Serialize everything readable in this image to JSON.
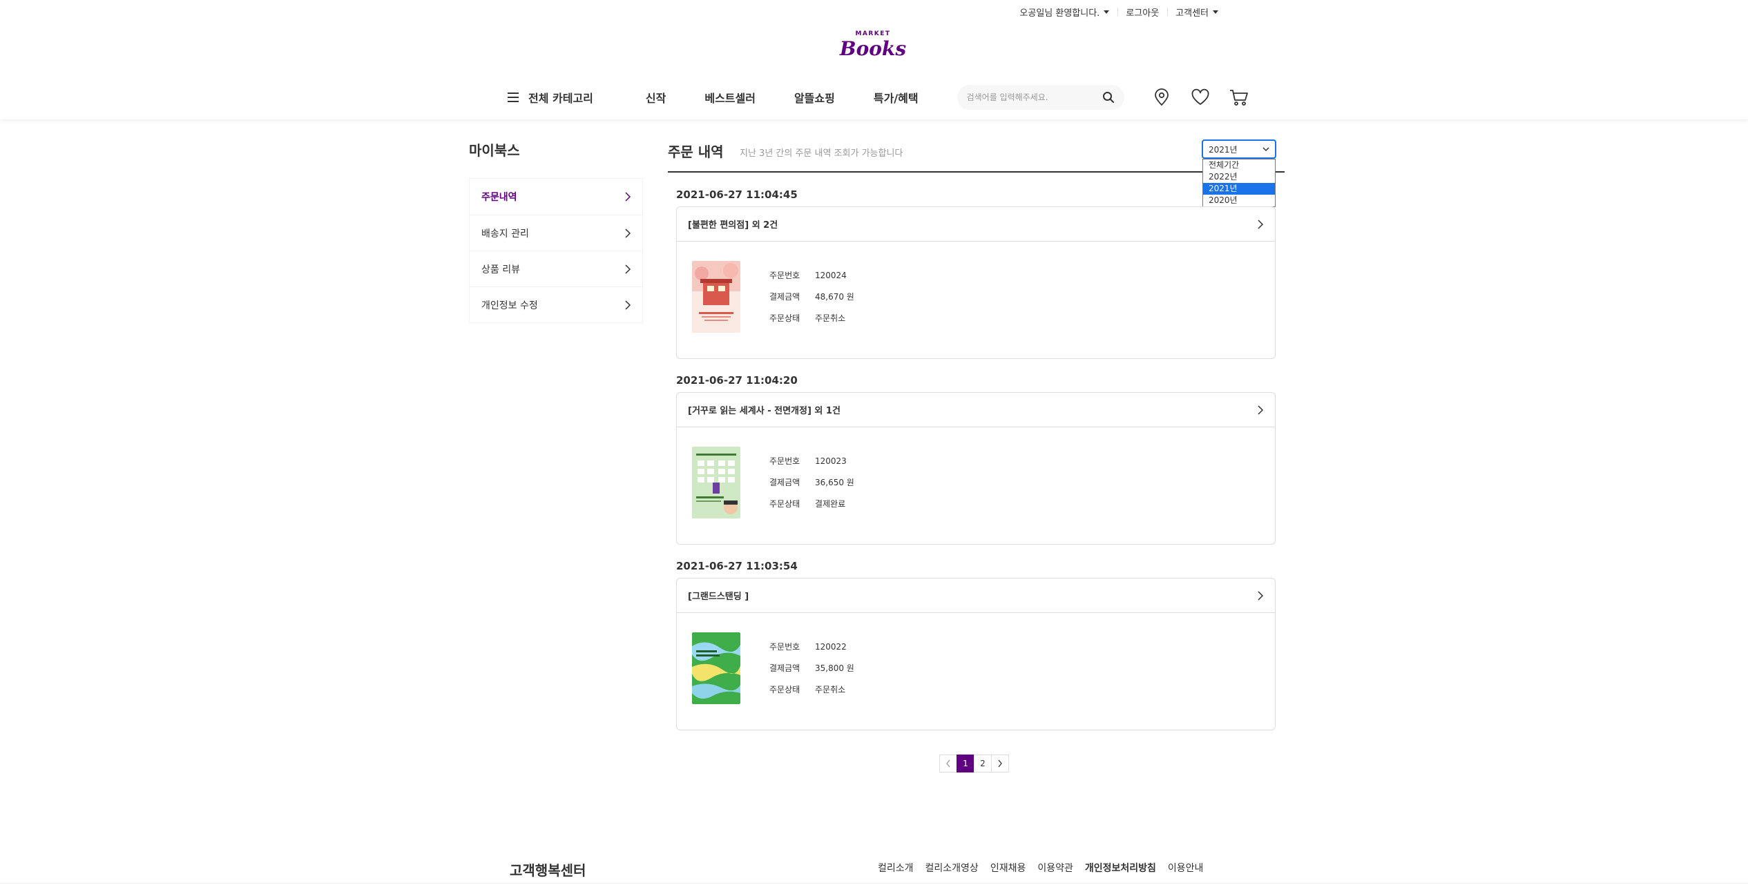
{
  "header": {
    "user_greeting": "오공일님 환영합니다.",
    "logout": "로그아웃",
    "customer_center": "고객센터",
    "logo_top": "MARKET",
    "logo_main": "Books"
  },
  "nav": {
    "category": "전체 카테고리",
    "menu": [
      "신작",
      "베스트셀러",
      "알뜰쇼핑",
      "특가/혜택"
    ],
    "search_placeholder": "검색어를 입력해주세요."
  },
  "sidebar": {
    "title": "마이북스",
    "items": [
      {
        "label": "주문내역"
      },
      {
        "label": "배송지 관리"
      },
      {
        "label": "상품 리뷰"
      },
      {
        "label": "개인정보 수정"
      }
    ]
  },
  "content": {
    "title": "주문 내역",
    "subtitle": "지난 3년 간의 주문 내역 조회가 가능합니다",
    "period_selected": "2021년",
    "period_options": [
      "전체기간",
      "2022년",
      "2021년",
      "2020년"
    ]
  },
  "orders": [
    {
      "date": "2021-06-27 11:04:45",
      "title": "[불편한 편의점] 외 2건",
      "fields": [
        {
          "label": "주문번호",
          "value": "120024"
        },
        {
          "label": "결제금액",
          "value": "48,670 원"
        },
        {
          "label": "주문상태",
          "value": "주문취소"
        }
      ]
    },
    {
      "date": "2021-06-27 11:04:20",
      "title": "[거꾸로 읽는 세계사 - 전면개정] 외 1건",
      "fields": [
        {
          "label": "주문번호",
          "value": "120023"
        },
        {
          "label": "결제금액",
          "value": "36,650 원"
        },
        {
          "label": "주문상태",
          "value": "결제완료"
        }
      ]
    },
    {
      "date": "2021-06-27 11:03:54",
      "title": "[그랜드스탠딩 ]",
      "fields": [
        {
          "label": "주문번호",
          "value": "120022"
        },
        {
          "label": "결제금액",
          "value": "35,800 원"
        },
        {
          "label": "주문상태",
          "value": "주문취소"
        }
      ]
    }
  ],
  "pagination": {
    "pages": [
      "1",
      "2"
    ],
    "current": "1"
  },
  "footer": {
    "title": "고객행복센터",
    "links": [
      {
        "label": "컬리소개"
      },
      {
        "label": "컬리소개영상"
      },
      {
        "label": "인재채용"
      },
      {
        "label": "이용약관"
      },
      {
        "label": "개인정보처리방침"
      },
      {
        "label": "이용안내"
      }
    ]
  },
  "colors": {
    "brand": "#5f0080",
    "select_highlight": "#1a73e8"
  }
}
